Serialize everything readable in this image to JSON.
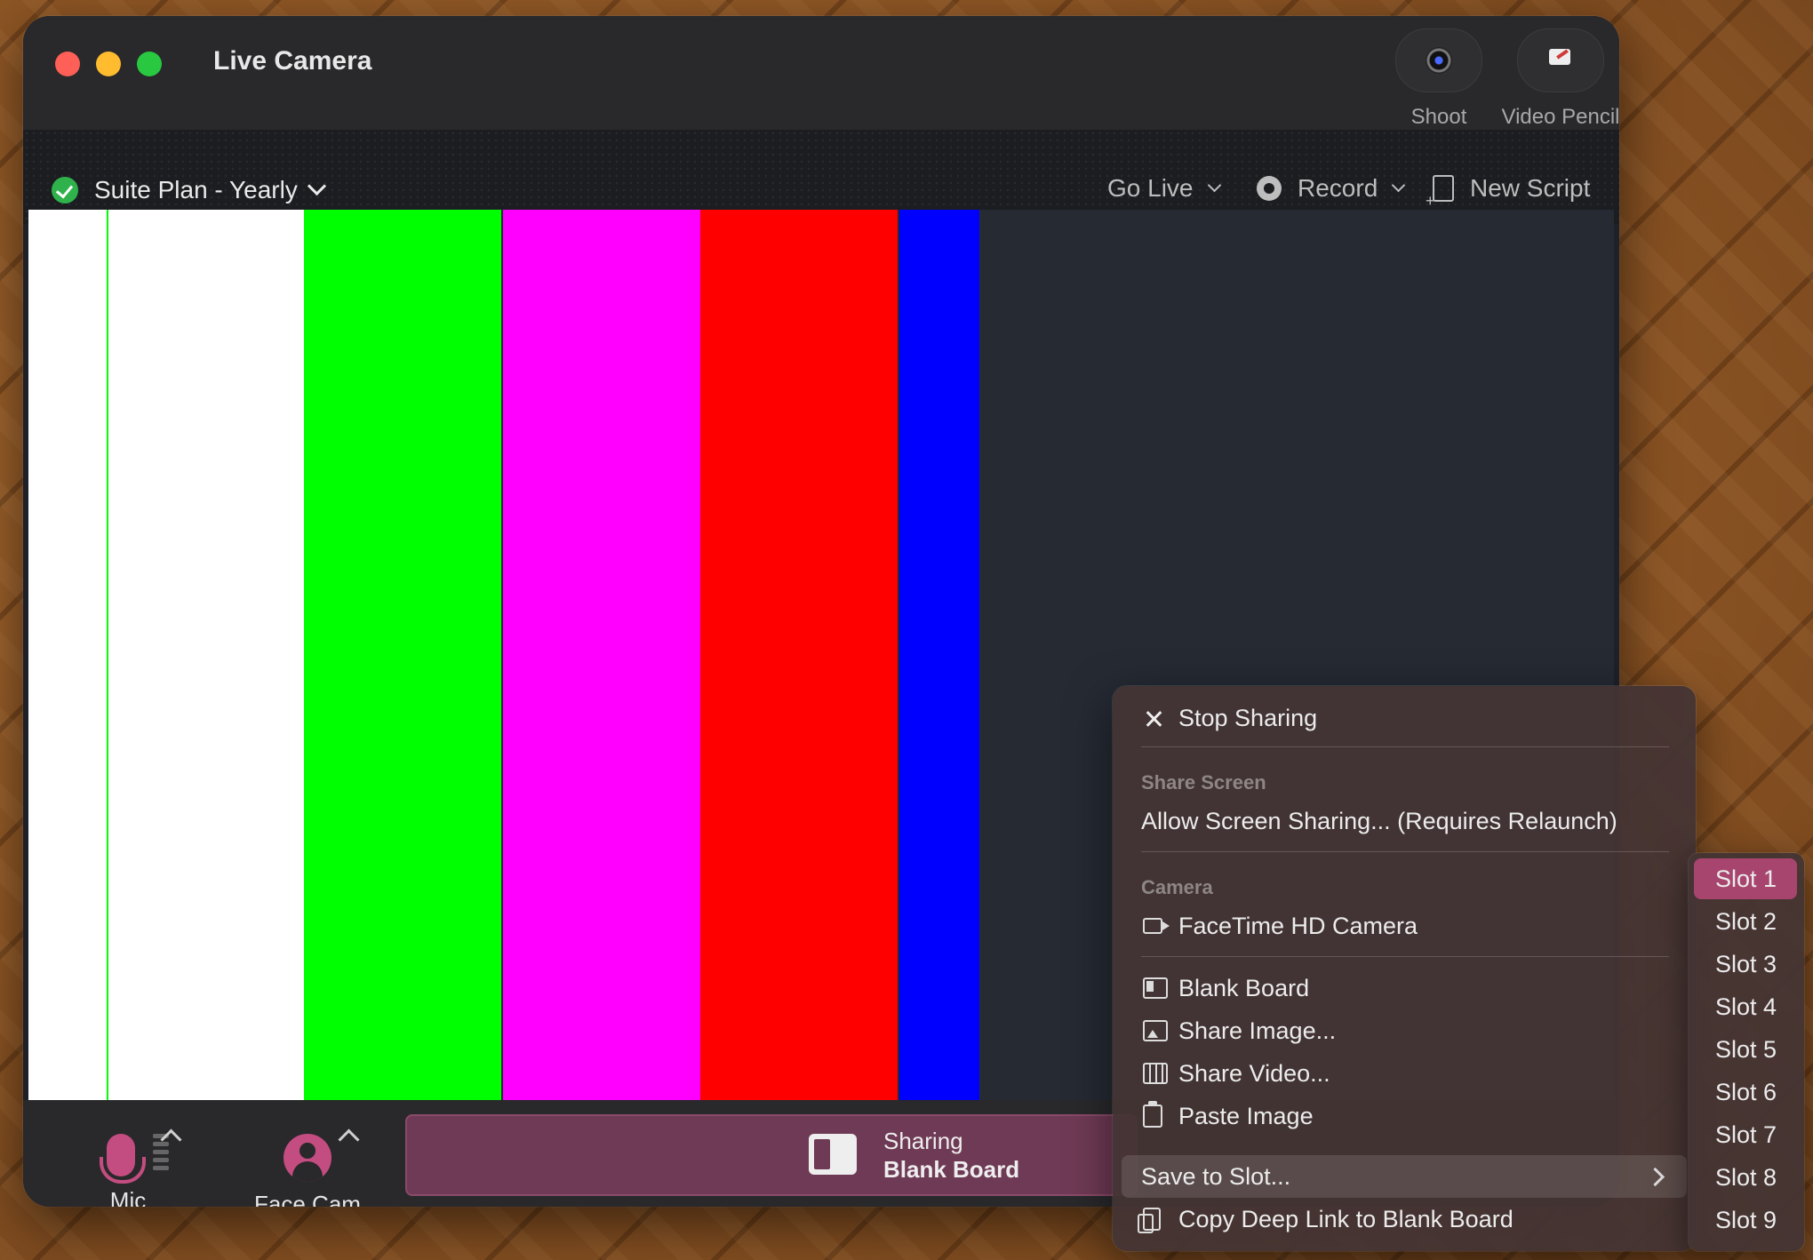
{
  "window": {
    "title": "Live Camera"
  },
  "header_tools": [
    {
      "label": "Shoot",
      "icon": "camera-lens-icon"
    },
    {
      "label": "Video Pencil",
      "icon": "video-pencil-icon"
    }
  ],
  "toolbar": {
    "plan_label": "Suite Plan - Yearly",
    "go_live_label": "Go Live",
    "record_label": "Record",
    "new_script_label": "New Script"
  },
  "stage": {
    "color_bars": [
      "#ffffff",
      "#00ff00",
      "#ff00ff",
      "#ff0000",
      "#0000ff"
    ],
    "background": "#252a33"
  },
  "bottom_bar": {
    "mic_label": "Mic",
    "facecam_label": "Face Cam",
    "sharing_label": "Sharing",
    "sharing_target": "Blank Board",
    "accent": "#c34d80"
  },
  "context_menu": {
    "stop_sharing": "Stop Sharing",
    "share_screen_section": "Share Screen",
    "allow_screen_sharing": "Allow Screen Sharing... (Requires Relaunch)",
    "camera_section": "Camera",
    "facetime_camera": "FaceTime HD Camera",
    "blank_board": "Blank Board",
    "share_image": "Share Image...",
    "share_video": "Share Video...",
    "paste_image": "Paste Image",
    "save_to_slot": "Save to Slot...",
    "copy_deep_link": "Copy Deep Link to Blank Board"
  },
  "slot_submenu": {
    "slots": [
      "Slot 1",
      "Slot 2",
      "Slot 3",
      "Slot 4",
      "Slot 5",
      "Slot 6",
      "Slot 7",
      "Slot 8",
      "Slot 9"
    ],
    "active_index": 0,
    "highlight_color": "#a8456f"
  }
}
